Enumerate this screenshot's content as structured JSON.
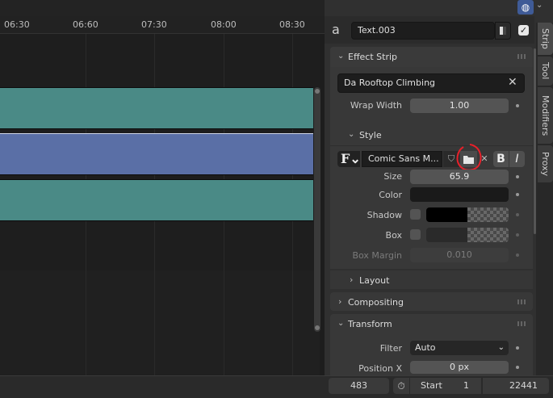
{
  "timeline": {
    "ticks": [
      "06:30",
      "06:60",
      "07:30",
      "08:00",
      "08:30"
    ],
    "strip_colors": [
      "#4a8a86",
      "#5a6fa6",
      "#4a8a86"
    ]
  },
  "properties": {
    "strip_name": "Text.003",
    "effect_strip_title": "Effect Strip",
    "text_value": "Da Rooftop Climbing",
    "wrap_width_label": "Wrap Width",
    "wrap_width_value": "1.00",
    "style_title": "Style",
    "font_name": "Comic Sans M...",
    "size_label": "Size",
    "size_value": "65.9",
    "color_label": "Color",
    "color_value": "#1a1a1a",
    "shadow_label": "Shadow",
    "shadow_color": "#000000",
    "box_label": "Box",
    "box_margin_label": "Box Margin",
    "box_margin_value": "0.010",
    "layout_title": "Layout",
    "compositing_title": "Compositing",
    "transform_title": "Transform",
    "filter_label": "Filter",
    "filter_value": "Auto",
    "position_x_label": "Position X",
    "position_x_value": "0 px"
  },
  "tabs": [
    "Strip",
    "Tool",
    "Modifiers",
    "Proxy"
  ],
  "bottom_bar": {
    "current_frame": "483",
    "start_label": "Start",
    "start_value": "1",
    "end_value": "22441"
  },
  "colors": {
    "annotation": "#e8202a"
  }
}
